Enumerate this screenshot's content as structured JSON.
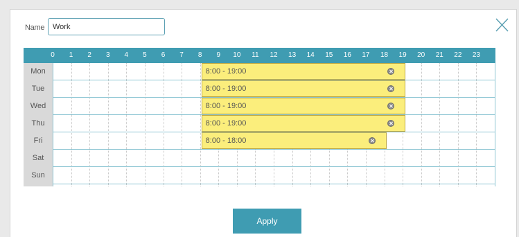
{
  "form": {
    "name_label": "Name",
    "name_value": "Work"
  },
  "schedule": {
    "hours": [
      "0",
      "1",
      "2",
      "3",
      "4",
      "5",
      "6",
      "7",
      "8",
      "9",
      "10",
      "11",
      "12",
      "13",
      "14",
      "15",
      "16",
      "17",
      "18",
      "19",
      "20",
      "21",
      "22",
      "23"
    ],
    "days": [
      "Mon",
      "Tue",
      "Wed",
      "Thu",
      "Fri",
      "Sat",
      "Sun"
    ],
    "blocks": [
      {
        "day": "Mon",
        "start": 8,
        "end": 19,
        "label": "8:00 - 19:00"
      },
      {
        "day": "Tue",
        "start": 8,
        "end": 19,
        "label": "8:00 - 19:00"
      },
      {
        "day": "Wed",
        "start": 8,
        "end": 19,
        "label": "8:00 - 19:00"
      },
      {
        "day": "Thu",
        "start": 8,
        "end": 19,
        "label": "8:00 - 19:00"
      },
      {
        "day": "Fri",
        "start": 8,
        "end": 18,
        "label": "8:00 - 18:00"
      }
    ],
    "colors": {
      "header": "#3f9cb2",
      "block": "#fbee7c",
      "day_column": "#d9d9d9"
    }
  },
  "actions": {
    "apply_label": "Apply",
    "close_icon": "close-icon"
  }
}
